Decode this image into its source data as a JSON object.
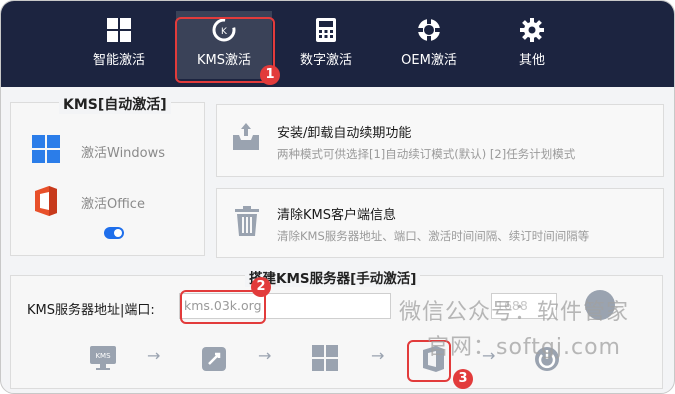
{
  "nav": [
    {
      "label": "智能激活",
      "icon": "grid-icon"
    },
    {
      "label": "KMS激活",
      "icon": "kms-refresh-icon"
    },
    {
      "label": "数字激活",
      "icon": "digital-calculator-icon"
    },
    {
      "label": "OEM激活",
      "icon": "lifebuoy-icon"
    },
    {
      "label": "其他",
      "icon": "gear-icon"
    }
  ],
  "callouts": [
    "1",
    "2",
    "3"
  ],
  "kms_auto": {
    "title": "KMS[自动激活]",
    "windows_label": "激活Windows",
    "office_label": "激活Office"
  },
  "cards": [
    {
      "title": "安装/卸载自动续期功能",
      "desc": "两种模式可供选择[1]自动续订模式(默认) [2]任务计划模式",
      "icon": "inbox-upload-icon"
    },
    {
      "title": "清除KMS客户端信息",
      "desc": "清除KMS服务器地址、端口、激活时间间隔、续订时间间隔等",
      "icon": "trash-icon"
    }
  ],
  "kms_server": {
    "title": "搭建KMS服务器[手动激活]",
    "address_label": "KMS服务器地址|端口:",
    "address_value": "kms.03k.org",
    "port_value": "1688"
  },
  "watermark": {
    "line1": "微信公众号：软件管家",
    "line2": "官网：softgj.com"
  },
  "colors": {
    "topbar": "#1c2440",
    "accent": "#1f6feb",
    "highlight": "#e23b3b"
  }
}
